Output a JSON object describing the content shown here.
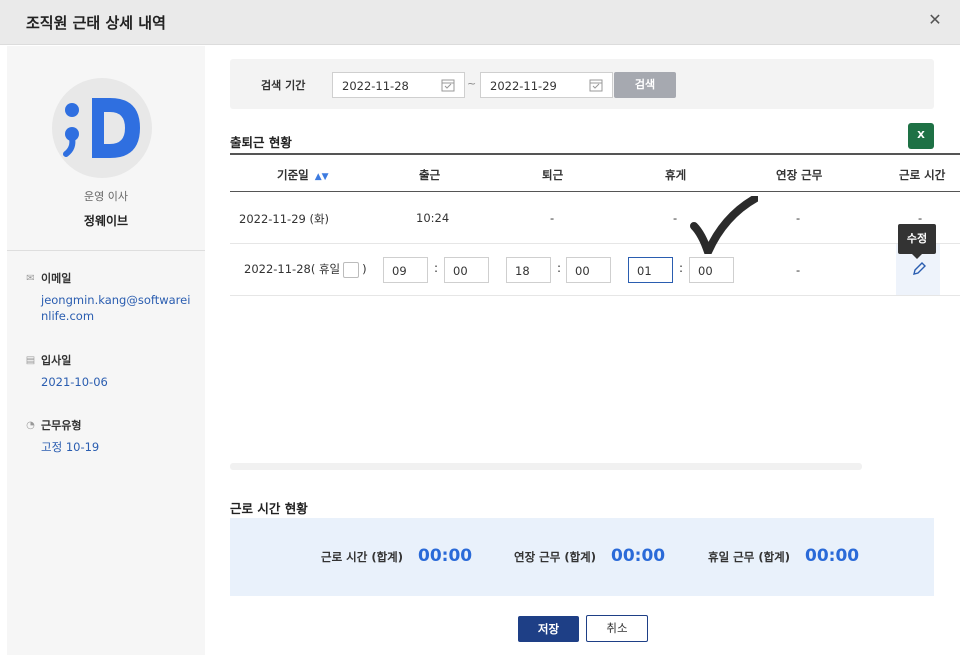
{
  "dialog": {
    "title": "조직원 근태 상세 내역",
    "close_glyph": "✕"
  },
  "profile": {
    "role": "운영 이사",
    "name": "정웨이브",
    "email_label": "이메일",
    "email": "jeongmin.kang@softwareinlife.com",
    "hire_label": "입사일",
    "hire_date": "2021-10-06",
    "worktype_label": "근무유형",
    "worktype": "고정 10-19",
    "avatar_color": "#2f6fe0"
  },
  "search": {
    "label": "검색 기간",
    "start_date": "2022-11-28",
    "end_date": "2022-11-29",
    "tilde": "~",
    "button": "검색"
  },
  "attendance": {
    "title": "출퇴근 현황",
    "excel_label": "X",
    "headers": [
      "기준일",
      "출근",
      "퇴근",
      "휴게",
      "연장 근무",
      "근로 시간"
    ],
    "sort_icon": "▲▼",
    "rows": [
      {
        "date": "2022-11-29 (화)",
        "in": "10:24",
        "out": "-",
        "break": "-",
        "overtime": "-",
        "work": "-"
      },
      {
        "date_prefix": "2022-11-28( 휴일",
        "date_suffix": ")",
        "in_h": "09",
        "in_m": "00",
        "out_h": "18",
        "out_m": "00",
        "break_h": "01",
        "break_m": "00",
        "colon": ":",
        "overtime": "-"
      }
    ],
    "tooltip": "수정"
  },
  "work_summary": {
    "title": "근로 시간 현황",
    "items": [
      {
        "label": "근로 시간 (합계)",
        "value": "00:00"
      },
      {
        "label": "연장 근무 (합계)",
        "value": "00:00"
      },
      {
        "label": "휴일 근무 (합계)",
        "value": "00:00"
      }
    ]
  },
  "actions": {
    "save": "저장",
    "cancel": "취소"
  }
}
